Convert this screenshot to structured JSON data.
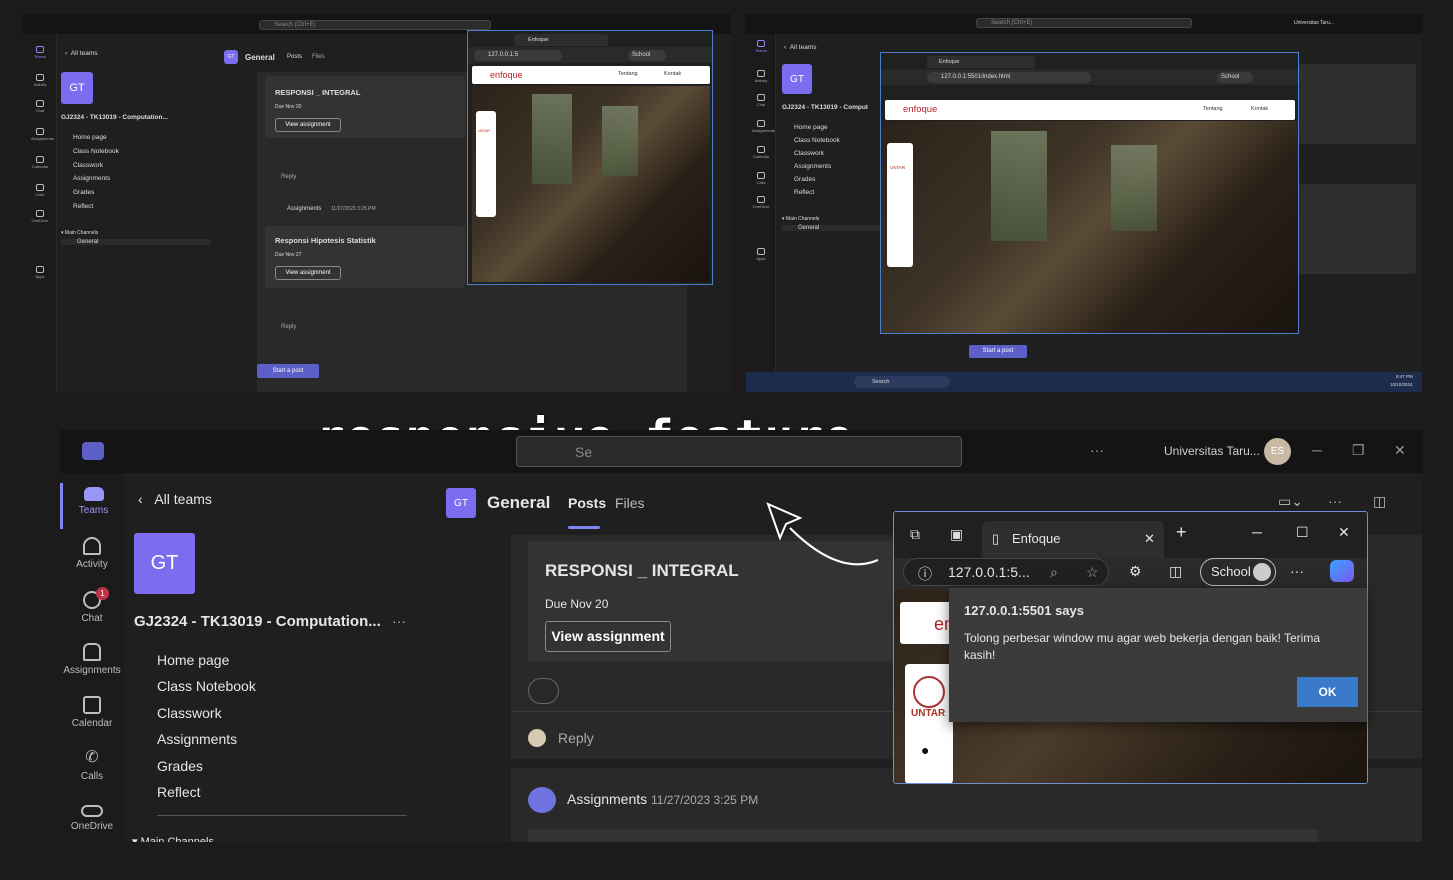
{
  "title": "responsive feature",
  "teams": {
    "search_placeholder": "Search (Ctrl+E)",
    "search_short": "Se",
    "back_label": "All teams",
    "team_avatar": "GT",
    "team_name": "GJ2324 - TK13019 - Computation...",
    "team_name_mini": "GJ2324 - TK13019 - Computation...",
    "team_name_mini2": "GJ2324 - TK13019 - Comput",
    "nav": [
      "Home page",
      "Class Notebook",
      "Classwork",
      "Assignments",
      "Grades",
      "Reflect"
    ],
    "channels_header": "Main Channels",
    "channel_general": "General",
    "channel_title": "General",
    "tabs": [
      "Posts",
      "Files"
    ],
    "rail": [
      "Teams",
      "Activity",
      "Chat",
      "Assignments",
      "Calendar",
      "Calls",
      "OneDrive",
      "Apps"
    ],
    "chat_badge": "1",
    "org_name": "Universitas Taru...",
    "user_initials": "ES",
    "posts": [
      {
        "title": "RESPONSI _ INTEGRAL",
        "due": "Due Nov 20",
        "button": "View assignment"
      },
      {
        "title": "Responsi Hipotesis Statistik",
        "due": "Due Nov 27",
        "button": "View assignment"
      }
    ],
    "reply_label": "Reply",
    "assignments_label": "Assignments",
    "assignments_time": "11/27/2023 3:25 PM",
    "start_post": "Start a post"
  },
  "browser": {
    "tab_title": "Enfoque",
    "address_short": "127.0.0.1:5...",
    "address_mini": "127.0.0.1:5",
    "address_full": "127.0.0.1:5501/index.html",
    "profile": "School",
    "site_brand": "enfoque",
    "site_nav": [
      "Tentang",
      "Kontak"
    ],
    "side_logo": "UNTAR"
  },
  "dialog": {
    "origin": "127.0.0.1:5501 says",
    "message": "Tolong perbesar window mu agar web bekerja dengan baik! Terima kasih!",
    "ok": "OK"
  },
  "taskbar": {
    "search": "Search",
    "time": "9:47 PM",
    "date": "10/10/2024"
  },
  "colors": {
    "accent": "#5b5fc7",
    "avatar": "#7b6cf0",
    "browser_border": "#6c8fd8",
    "brand_red": "#b3262b"
  }
}
